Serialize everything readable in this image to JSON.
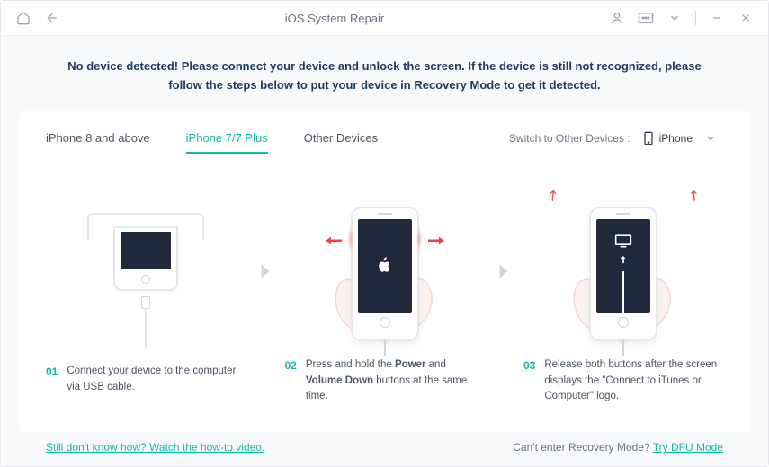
{
  "titlebar": {
    "title": "iOS System Repair"
  },
  "warning_text": "No device detected! Please connect your device and unlock the screen. If the device is still not recognized, please follow the steps below to put your device in Recovery Mode to get it detected.",
  "tabs": [
    {
      "label": "iPhone 8 and above"
    },
    {
      "label": "iPhone 7/7 Plus"
    },
    {
      "label": "Other Devices"
    }
  ],
  "switch_label": "Switch to Other Devices :",
  "selected_device": "iPhone",
  "steps": [
    {
      "num": "01",
      "desc_plain": "Connect your device to the computer via USB cable."
    },
    {
      "num": "02",
      "desc_pre": "Press and hold the ",
      "desc_b1": "Power",
      "desc_mid": " and ",
      "desc_b2": "Volume Down",
      "desc_post": " buttons at the same time."
    },
    {
      "num": "03",
      "desc_plain": "Release both buttons after the screen displays the \"Connect to iTunes or Computer\" logo."
    }
  ],
  "footer": {
    "left_link": "Still don't know how? Watch the how-to video.",
    "right_text": "Can't enter Recovery Mode? ",
    "right_link": "Try DFU Mode"
  }
}
